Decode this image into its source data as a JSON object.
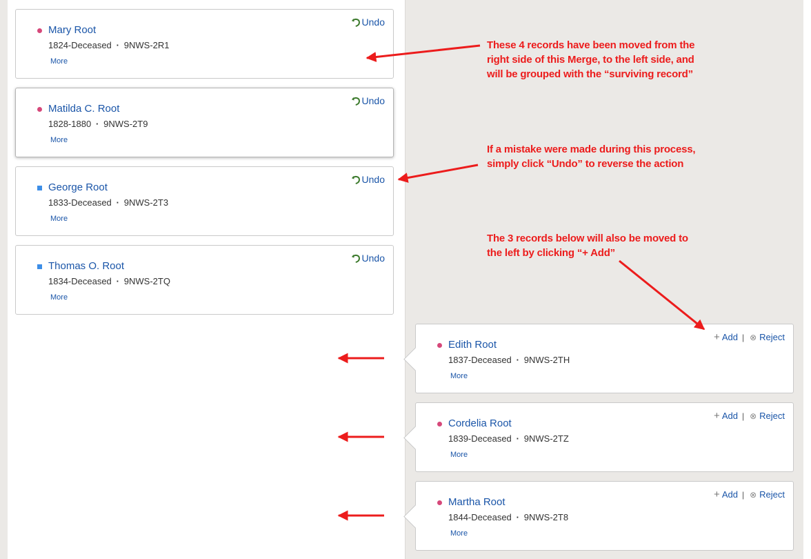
{
  "left_cards": [
    {
      "name": "Mary Root",
      "sex": "female",
      "dates": "1824-Deceased",
      "id": "9NWS-2R1",
      "more": "More",
      "action": "Undo"
    },
    {
      "name": "Matilda C. Root",
      "sex": "female",
      "dates": "1828-1880",
      "id": "9NWS-2T9",
      "more": "More",
      "action": "Undo"
    },
    {
      "name": "George Root",
      "sex": "male",
      "dates": "1833-Deceased",
      "id": "9NWS-2T3",
      "more": "More",
      "action": "Undo"
    },
    {
      "name": "Thomas O. Root",
      "sex": "male",
      "dates": "1834-Deceased",
      "id": "9NWS-2TQ",
      "more": "More",
      "action": "Undo"
    }
  ],
  "right_cards": [
    {
      "name": "Edith Root",
      "sex": "female",
      "dates": "1837-Deceased",
      "id": "9NWS-2TH",
      "more": "More",
      "add": "Add",
      "reject": "Reject"
    },
    {
      "name": "Cordelia Root",
      "sex": "female",
      "dates": "1839-Deceased",
      "id": "9NWS-2TZ",
      "more": "More",
      "add": "Add",
      "reject": "Reject"
    },
    {
      "name": "Martha Root",
      "sex": "female",
      "dates": "1844-Deceased",
      "id": "9NWS-2T8",
      "more": "More",
      "add": "Add",
      "reject": "Reject"
    }
  ],
  "annotations": {
    "a1": [
      "These 4 records have been moved from the",
      "right side of this Merge, to the left side, and",
      "will be grouped with the “surviving record”"
    ],
    "a2": [
      "If a mistake were made during this process,",
      "simply click “Undo” to reverse the action"
    ],
    "a3": [
      "The 3 records below will also be moved to",
      "the left by clicking “+ Add”"
    ]
  },
  "icons": {
    "undo": "undo-arrow-icon",
    "add": "plus-icon",
    "reject": "circle-x-icon",
    "female": "female-dot-icon",
    "male": "male-square-icon"
  },
  "colors": {
    "link": "#1a55a8",
    "female": "#d6487a",
    "male": "#3d8ee7",
    "annotation": "#ec1c1c",
    "undo_icon": "#3c7a2c",
    "panel_bg": "#ebe9e6"
  }
}
